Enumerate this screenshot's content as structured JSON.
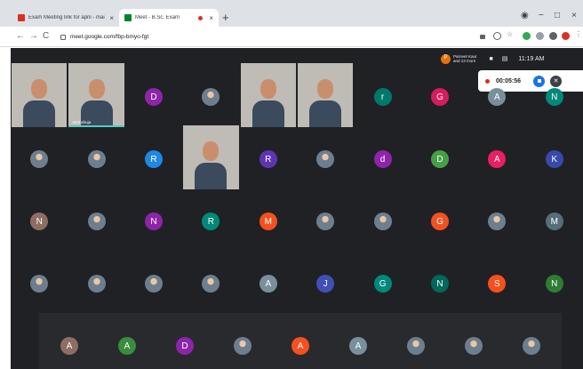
{
  "browser": {
    "tabs": [
      {
        "title": "Exam Meeting link for april - mai",
        "close": "×",
        "favicon_color": "#d93025"
      },
      {
        "title": "Meet - B.Sc. Exam",
        "close": "×",
        "favicon_color": "#00832d",
        "recording": true
      }
    ],
    "new_tab": "+",
    "window_controls": {
      "minimize": "−",
      "maximize": "□",
      "close": "×"
    },
    "nav": {
      "back": "←",
      "forward": "→",
      "reload": "C"
    },
    "url": "meet.google.com/fbp-bmyo-fgt"
  },
  "meet": {
    "participants_chip": "P",
    "participants_text_1": "Parneet Kaur",
    "participants_text_2": "and 13 more",
    "time": "11:19 AM",
    "recording_timer": "00:05:56",
    "speaker_label": "amit ahuja",
    "rows": [
      [
        {
          "type": "video"
        },
        {
          "type": "video",
          "label": true
        },
        {
          "type": "avatar",
          "letter": "D",
          "color": "#8e24aa"
        },
        {
          "type": "photo"
        },
        {
          "type": "video"
        },
        {
          "type": "video"
        },
        {
          "type": "avatar",
          "letter": "r",
          "color": "#00796b"
        },
        {
          "type": "avatar",
          "letter": "G",
          "color": "#d81b60"
        },
        {
          "type": "avatar",
          "letter": "A",
          "color": "#78909c"
        },
        {
          "type": "avatar",
          "letter": "N",
          "color": "#00897b"
        }
      ],
      [
        {
          "type": "photo"
        },
        {
          "type": "photo"
        },
        {
          "type": "avatar",
          "letter": "R",
          "color": "#1e88e5"
        },
        {
          "type": "video"
        },
        {
          "type": "avatar",
          "letter": "R",
          "color": "#5e35b1"
        },
        {
          "type": "photo"
        },
        {
          "type": "avatar",
          "letter": "d",
          "color": "#8e24aa"
        },
        {
          "type": "avatar",
          "letter": "D",
          "color": "#43a047"
        },
        {
          "type": "avatar",
          "letter": "A",
          "color": "#e91e63"
        },
        {
          "type": "avatar",
          "letter": "K",
          "color": "#3949ab"
        }
      ],
      [
        {
          "type": "avatar",
          "letter": "N",
          "color": "#8d6e63"
        },
        {
          "type": "photo"
        },
        {
          "type": "avatar",
          "letter": "N",
          "color": "#8e24aa"
        },
        {
          "type": "avatar",
          "letter": "R",
          "color": "#00897b"
        },
        {
          "type": "avatar",
          "letter": "M",
          "color": "#f4511e"
        },
        {
          "type": "photo"
        },
        {
          "type": "photo"
        },
        {
          "type": "avatar",
          "letter": "G",
          "color": "#f4511e"
        },
        {
          "type": "photo"
        },
        {
          "type": "avatar",
          "letter": "M",
          "color": "#546e7a"
        }
      ],
      [
        {
          "type": "photo"
        },
        {
          "type": "photo"
        },
        {
          "type": "photo"
        },
        {
          "type": "photo"
        },
        {
          "type": "avatar",
          "letter": "A",
          "color": "#78909c"
        },
        {
          "type": "avatar",
          "letter": "J",
          "color": "#3f51b5"
        },
        {
          "type": "avatar",
          "letter": "G",
          "color": "#00897b"
        },
        {
          "type": "avatar",
          "letter": "N",
          "color": "#00695c"
        },
        {
          "type": "avatar",
          "letter": "S",
          "color": "#f4511e"
        },
        {
          "type": "avatar",
          "letter": "N",
          "color": "#2e7d32"
        }
      ],
      [
        {
          "type": "avatar",
          "letter": "A",
          "color": "#8d6e63"
        },
        {
          "type": "avatar",
          "letter": "A",
          "color": "#388e3c"
        },
        {
          "type": "avatar",
          "letter": "D",
          "color": "#8e24aa"
        },
        {
          "type": "photo"
        },
        {
          "type": "avatar",
          "letter": "A",
          "color": "#f4511e"
        },
        {
          "type": "avatar",
          "letter": "A",
          "color": "#78909c"
        },
        {
          "type": "photo"
        },
        {
          "type": "photo"
        },
        {
          "type": "photo"
        }
      ]
    ]
  }
}
